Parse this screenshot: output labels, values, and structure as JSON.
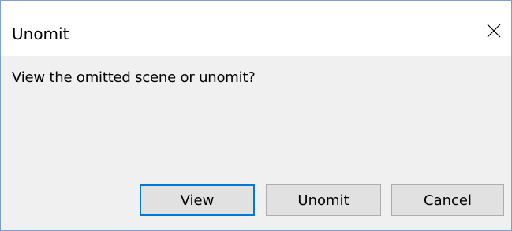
{
  "window": {
    "title": "Unomit",
    "close_icon": "close-icon"
  },
  "message": "View the omitted scene or unomit?",
  "buttons": {
    "view": "View",
    "unomit": "Unomit",
    "cancel": "Cancel"
  },
  "colors": {
    "dialog_bg": "#f0f0f0",
    "titlebar_bg": "#ffffff",
    "button_bg": "#e1e1e1",
    "button_border": "#adadad",
    "default_button_border": "#0078d7",
    "window_border": "#7a9fd0"
  }
}
